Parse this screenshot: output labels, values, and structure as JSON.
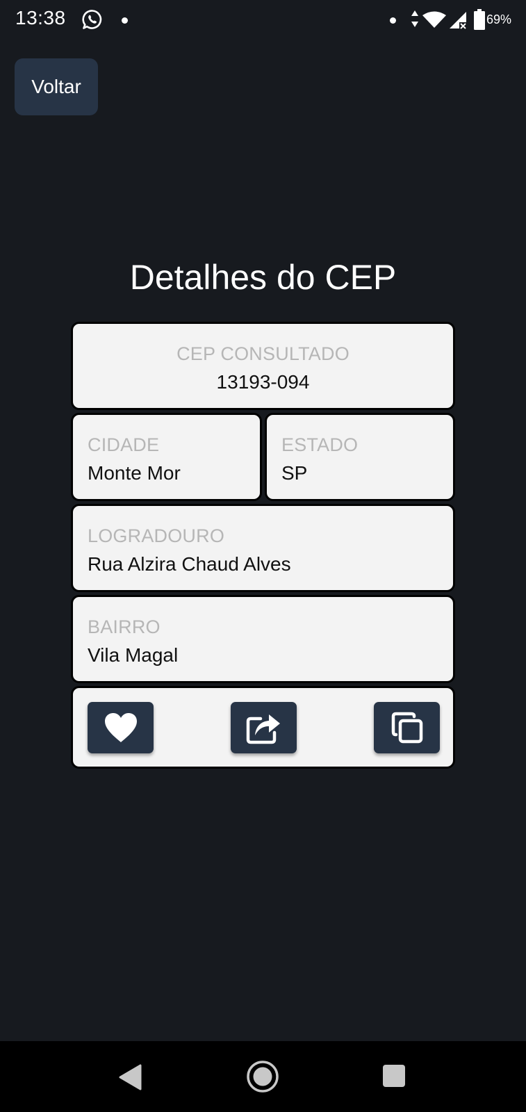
{
  "status_bar": {
    "time": "13:38",
    "battery": "69%",
    "icons": [
      "whatsapp-icon",
      "notification-dot-icon",
      "data-arrows-icon",
      "wifi-icon",
      "signal-no-data-icon",
      "battery-icon"
    ]
  },
  "header": {
    "back_label": "Voltar"
  },
  "page": {
    "title": "Detalhes do CEP"
  },
  "details": {
    "cep": {
      "label": "CEP CONSULTADO",
      "value": "13193-094"
    },
    "cidade": {
      "label": "CIDADE",
      "value": "Monte Mor"
    },
    "estado": {
      "label": "ESTADO",
      "value": "SP"
    },
    "logradouro": {
      "label": "LOGRADOURO",
      "value": "Rua Alzira Chaud Alves"
    },
    "bairro": {
      "label": "BAIRRO",
      "value": "Vila Magal"
    }
  },
  "actions": [
    {
      "icon": "heart-icon"
    },
    {
      "icon": "share-icon"
    },
    {
      "icon": "copy-icon"
    }
  ],
  "colors": {
    "background": "#171a1f",
    "button": "#273446",
    "card": "#f3f3f3",
    "label": "#b6b6b6",
    "value": "#111111"
  },
  "nav_bar": {
    "icons": [
      "back-triangle-icon",
      "home-circle-icon",
      "recents-square-icon"
    ]
  }
}
